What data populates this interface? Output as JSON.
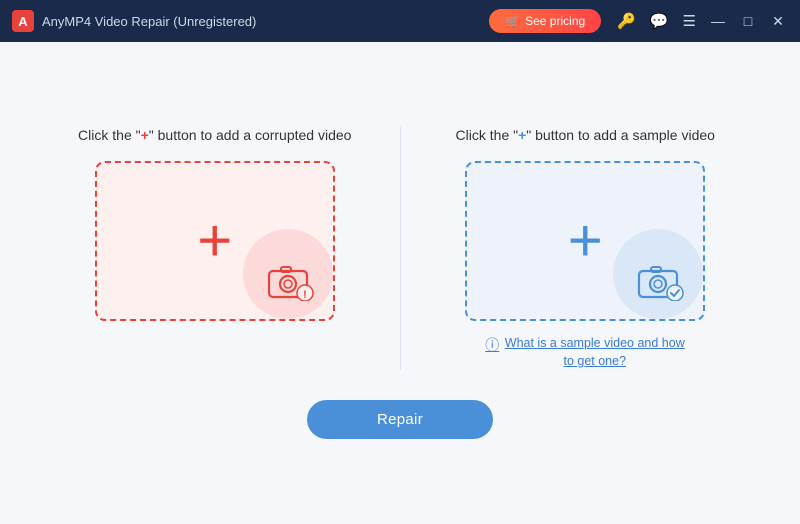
{
  "titlebar": {
    "logo_alt": "AnyMP4 logo",
    "title": "AnyMP4 Video Repair (Unregistered)",
    "pricing_label": "See pricing",
    "pricing_icon": "🛒",
    "icon_key": "🔑",
    "icon_chat": "💬",
    "icon_menu": "☰",
    "btn_minimize": "—",
    "btn_maximize": "□",
    "btn_close": "✕"
  },
  "left_panel": {
    "title_prefix": "Click the \"",
    "title_plus": "+",
    "title_suffix": "\" button to add a corrupted video",
    "drop_hint": "Add corrupted video"
  },
  "right_panel": {
    "title_prefix": "Click the \"",
    "title_plus": "+",
    "title_suffix": "\" button to add a sample video",
    "drop_hint": "Add sample video",
    "help_link": "What is a sample video and how to get one?"
  },
  "repair_button": {
    "label": "Repair"
  },
  "colors": {
    "accent_red": "#e8433a",
    "accent_blue": "#4a90d9",
    "titlebar_bg": "#1a2a4a"
  }
}
